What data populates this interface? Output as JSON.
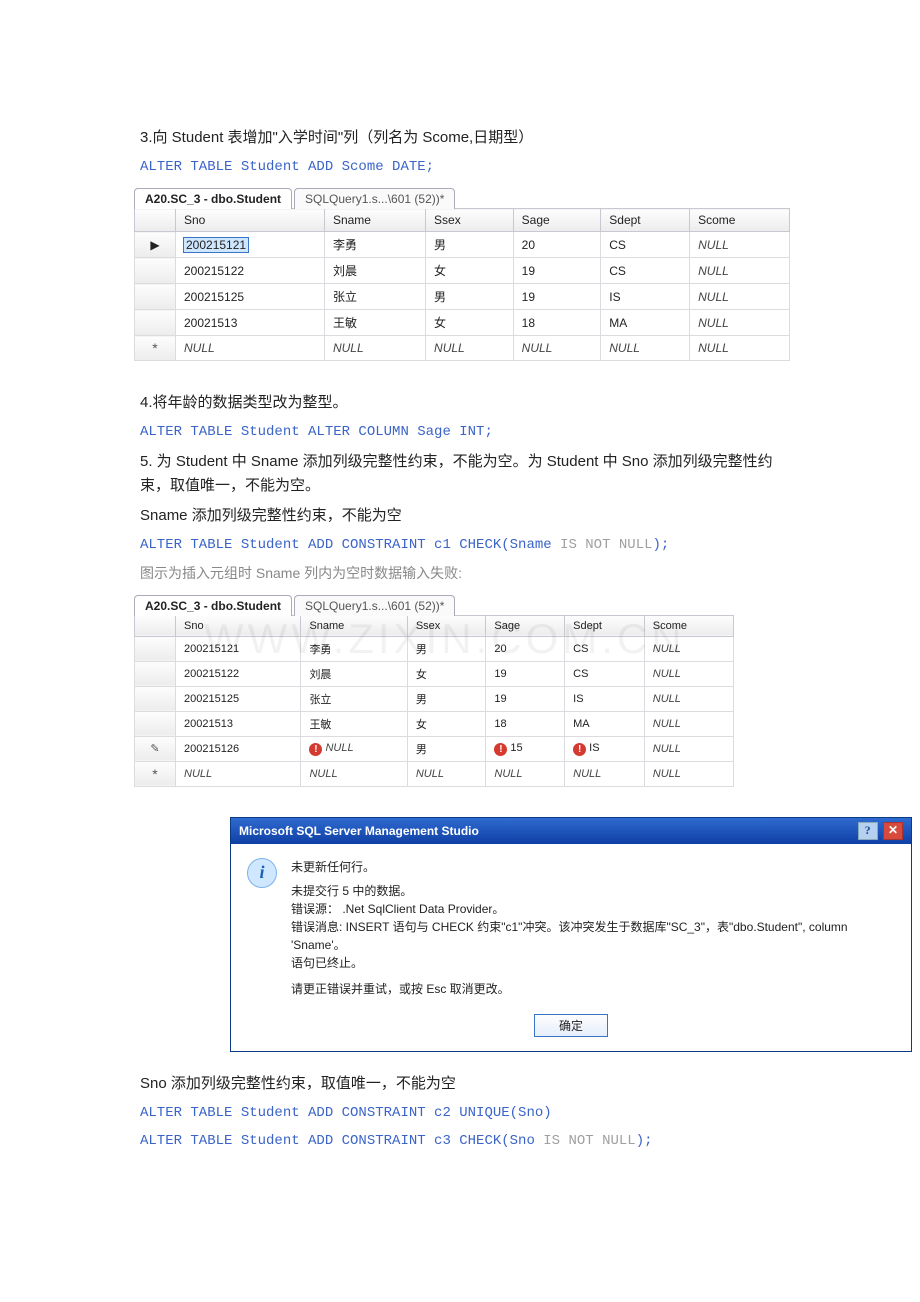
{
  "sec3": {
    "heading": "3.向 Student 表增加\"入学时间\"列（列名为 Scome,日期型）",
    "sql": "ALTER TABLE Student ADD Scome DATE;"
  },
  "grid1": {
    "tab_active": "A20.SC_3 - dbo.Student",
    "tab_inactive": "SQLQuery1.s...\\601 (52))*",
    "columns": [
      "Sno",
      "Sname",
      "Ssex",
      "Sage",
      "Sdept",
      "Scome"
    ],
    "rows": [
      {
        "marker": "▶",
        "cells": [
          "200215121",
          "李勇",
          "男",
          "20",
          "CS",
          "NULL"
        ],
        "sel": 0
      },
      {
        "marker": "",
        "cells": [
          "200215122",
          "刘晨",
          "女",
          "19",
          "CS",
          "NULL"
        ]
      },
      {
        "marker": "",
        "cells": [
          "200215125",
          "张立",
          "男",
          "19",
          "IS",
          "NULL"
        ]
      },
      {
        "marker": "",
        "cells": [
          "20021513",
          "王敏",
          "女",
          "18",
          "MA",
          "NULL"
        ]
      },
      {
        "marker": "*",
        "cells": [
          "NULL",
          "NULL",
          "NULL",
          "NULL",
          "NULL",
          "NULL"
        ]
      }
    ]
  },
  "sec4": {
    "heading": "4.将年龄的数据类型改为整型。",
    "sql": "ALTER TABLE Student ALTER COLUMN Sage INT;"
  },
  "sec5": {
    "heading1": "5. 为 Student 中 Sname 添加列级完整性约束，不能为空。为 Student 中 Sno 添加列级完整性约束，取值唯一，不能为空。",
    "heading2": "Sname 添加列级完整性约束，不能为空",
    "sql1_a": "ALTER TABLE Student ADD CONSTRAINT c1 CHECK(Sname ",
    "sql1_b": "IS NOT NULL",
    "sql1_c": ");",
    "note": "图示为插入元组时 Sname 列内为空时数据输入失败:"
  },
  "grid2": {
    "tab_active": "A20.SC_3 - dbo.Student",
    "tab_inactive": "SQLQuery1.s...\\601 (52))*",
    "columns": [
      "Sno",
      "Sname",
      "Ssex",
      "Sage",
      "Sdept",
      "Scome"
    ],
    "rows": [
      {
        "marker": "",
        "cells": [
          "200215121",
          "李勇",
          "男",
          "20",
          "CS",
          "NULL"
        ]
      },
      {
        "marker": "",
        "cells": [
          "200215122",
          "刘晨",
          "女",
          "19",
          "CS",
          "NULL"
        ]
      },
      {
        "marker": "",
        "cells": [
          "200215125",
          "张立",
          "男",
          "19",
          "IS",
          "NULL"
        ]
      },
      {
        "marker": "",
        "cells": [
          "20021513",
          "王敏",
          "女",
          "18",
          "MA",
          "NULL"
        ]
      },
      {
        "marker": "✎",
        "cells": [
          "200215126",
          "NULL",
          "男",
          "15",
          "IS",
          "NULL"
        ],
        "err": [
          1,
          3,
          4
        ]
      },
      {
        "marker": "*",
        "cells": [
          "NULL",
          "NULL",
          "NULL",
          "NULL",
          "NULL",
          "NULL"
        ]
      }
    ]
  },
  "dialog": {
    "title": "Microsoft SQL Server Management Studio",
    "line1": "未更新任何行。",
    "line2": "未提交行 5 中的数据。",
    "line3": "错误源： .Net SqlClient Data Provider。",
    "line4": "错误消息: INSERT 语句与 CHECK 约束\"c1\"冲突。该冲突发生于数据库\"SC_3\"，表\"dbo.Student\", column 'Sname'。",
    "line5": "语句已终止。",
    "line6": "请更正错误并重试，或按 Esc 取消更改。",
    "ok": "确定"
  },
  "sec6": {
    "heading": "Sno 添加列级完整性约束，取值唯一，不能为空",
    "sql_a": "ALTER TABLE Student ADD CONSTRAINT c2 UNIQUE(Sno)",
    "sql_b_a": "ALTER TABLE Student ADD CONSTRAINT c3 CHECK(Sno ",
    "sql_b_b": "IS NOT NULL",
    "sql_b_c": ");"
  },
  "watermark": "WWW.ZIXIN.COM.CN"
}
